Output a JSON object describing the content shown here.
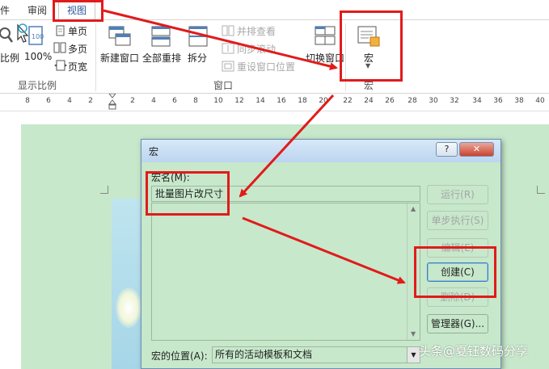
{
  "ribbon": {
    "tabs": [
      "件",
      "审阅",
      "视图"
    ],
    "zoom_group": {
      "label": "显示比例",
      "zoom_label": "比例",
      "hundred_label": "100%",
      "single_page": "单页",
      "multi_page": "多页",
      "page_width": "页宽"
    },
    "window_group": {
      "label": "窗口",
      "new_window": "新建窗口",
      "arrange_all": "全部重排",
      "split": "拆分",
      "side_by_side": "并排查看",
      "sync_scroll": "同步滚动",
      "reset_position": "重设窗口位置",
      "switch_window": "切换窗口"
    },
    "macro_group": {
      "label": "宏",
      "macro_button": "宏"
    }
  },
  "ruler": {
    "ticks": [
      "8",
      "6",
      "4",
      "2",
      "2",
      "4",
      "6",
      "8",
      "10",
      "12",
      "14",
      "16",
      "18",
      "20",
      "22",
      "24",
      "26",
      "28",
      "30",
      "32",
      "34",
      "36",
      "38",
      "40"
    ]
  },
  "dialog": {
    "title": "宏",
    "help_label": "?",
    "close_label": "✕",
    "macro_name_label": "宏名(M):",
    "macro_name_value": "批量图片改尺寸",
    "buttons": {
      "run": "运行(R)",
      "step_into": "单步执行(S)",
      "edit": "编辑(E)",
      "create": "创建(C)",
      "delete": "删除(D)",
      "organizer": "管理器(G)..."
    },
    "macros_in_label": "宏的位置(A):",
    "macros_in_value": "所有的活动模板和文档"
  },
  "watermark": "头条@夏钰数码分享",
  "colors": {
    "dialog_background": "#c7e8cb",
    "annotation_red": "#e11b1b",
    "active_tab": "#2b579a"
  }
}
